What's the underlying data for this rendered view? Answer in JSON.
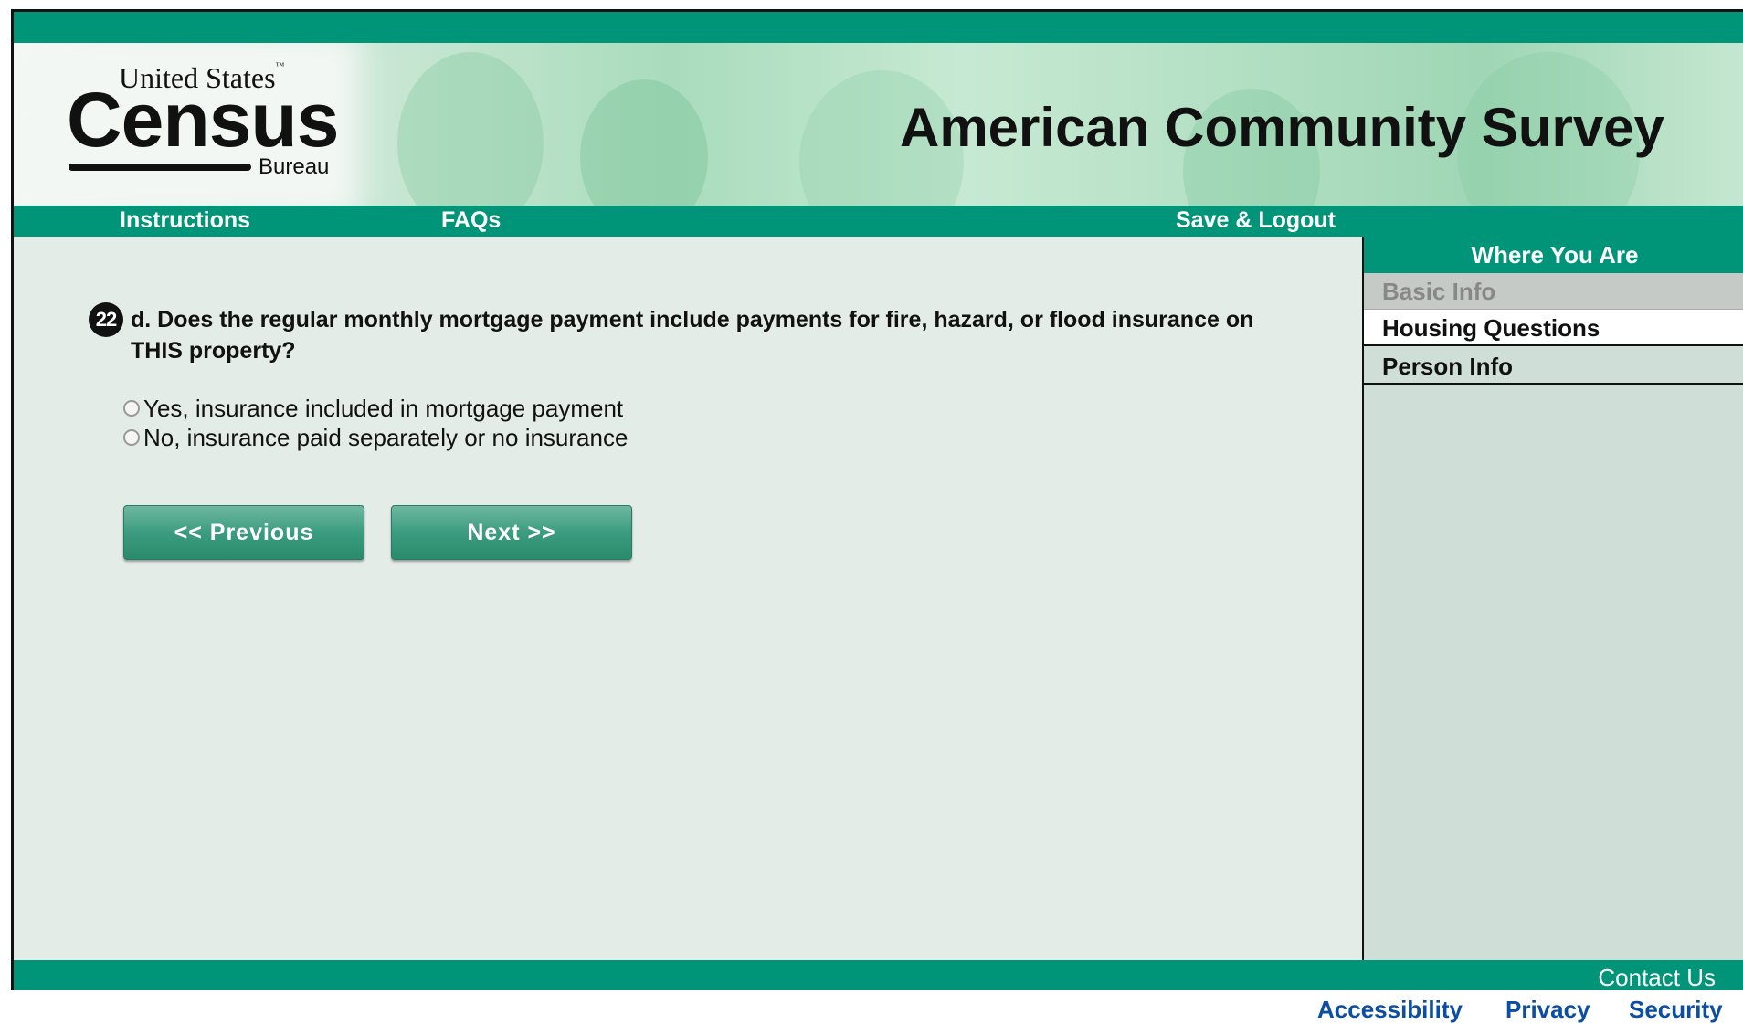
{
  "logo": {
    "top_text": "United States",
    "tm": "™",
    "main_text": "Census",
    "sub_text": "Bureau"
  },
  "header": {
    "title": "American Community Survey"
  },
  "nav": {
    "instructions": "Instructions",
    "faqs": "FAQs",
    "save_logout": "Save & Logout"
  },
  "question": {
    "number": "22",
    "text": "d. Does the regular monthly mortgage payment include payments for fire, hazard, or flood insurance on THIS property?",
    "options": [
      {
        "label": "Yes, insurance included in mortgage payment",
        "selected": false
      },
      {
        "label": "No, insurance paid separately or no insurance",
        "selected": false
      }
    ]
  },
  "buttons": {
    "previous": "<<  Previous",
    "next": "Next  >>"
  },
  "sidebar": {
    "title": "Where You Are",
    "items": [
      {
        "label": "Basic Info",
        "state": "disabled"
      },
      {
        "label": "Housing Questions",
        "state": "current"
      },
      {
        "label": "Person Info",
        "state": "normal"
      }
    ]
  },
  "footer": {
    "contact": "Contact Us",
    "links": [
      "Accessibility",
      "Privacy",
      "Security"
    ]
  },
  "colors": {
    "brand_green": "#009578",
    "link_blue": "#0b4ea2",
    "background": "#e4ece8"
  }
}
